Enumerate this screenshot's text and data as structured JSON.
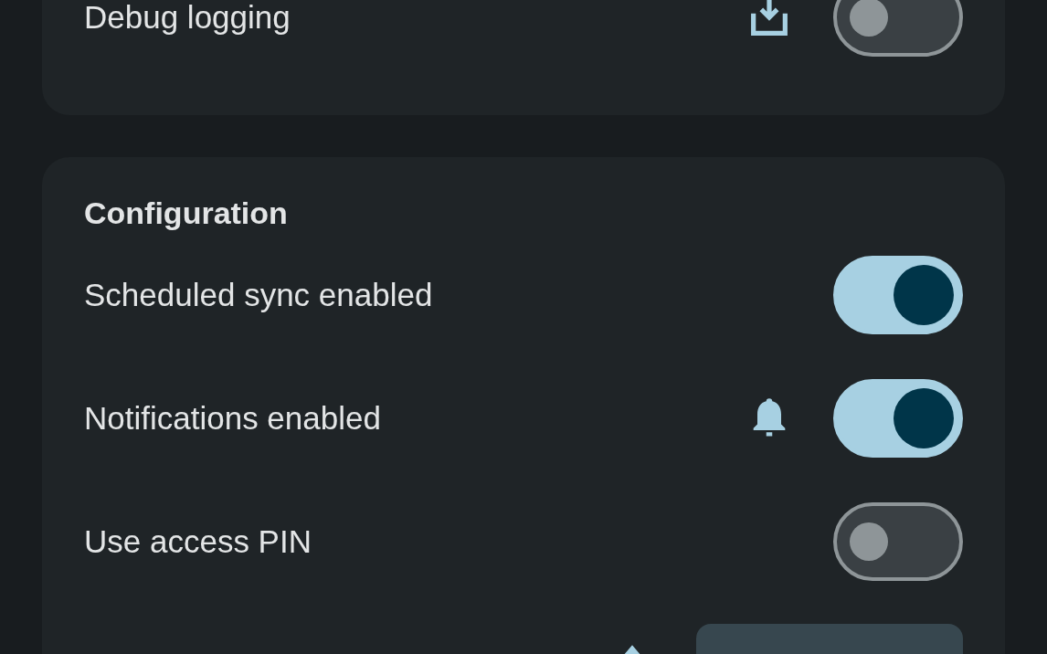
{
  "cards": [
    {
      "rows": [
        {
          "kind": "exporttoggle",
          "label": "Debug logging",
          "on": false
        }
      ]
    },
    {
      "title": "Configuration",
      "rows": [
        {
          "kind": "toggle",
          "label": "Scheduled sync enabled",
          "on": true
        },
        {
          "kind": "alerttoggle",
          "label": "Notifications enabled",
          "on": true
        },
        {
          "kind": "toggle",
          "label": "Use access PIN",
          "on": false
        },
        {
          "kind": "button"
        }
      ]
    }
  ]
}
